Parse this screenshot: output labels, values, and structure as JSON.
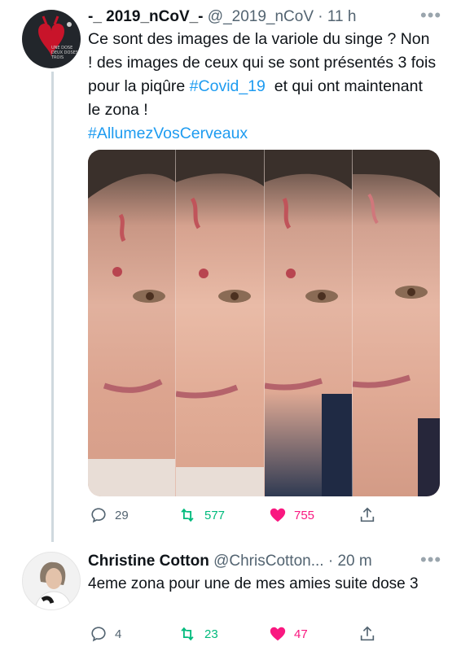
{
  "tweet1": {
    "name": "-_ 2019_nCoV_-",
    "handle": "@_2019_nCoV",
    "time": "· 11 h",
    "avatar_text": "UNE DOSE DEUX DOSES TROIS",
    "text_plain": "Ce sont des images de la variole du singe ? Non ! des images de ceux qui se sont présentés 3 fois pour la piqûre ",
    "hashtag1": "#Covid_19",
    "text_after": "  et qui ont maintenant le zona !",
    "hashtag2": "#AllumezVosCerveaux",
    "replies": "29",
    "retweets": "577",
    "likes": "755",
    "more_icon": "more-horizontal-icon"
  },
  "tweet2": {
    "name": "Christine Cotton",
    "handle": "@ChrisCotton...",
    "time": "· 20 m",
    "text": "4eme zona pour une de mes amies suite dose 3",
    "replies": "4",
    "retweets": "23",
    "likes": "47"
  },
  "colors": {
    "text": "#0f1419",
    "secondary": "#536471",
    "link": "#1d9bf0",
    "retweet": "#00ba7c",
    "like": "#f91880"
  }
}
